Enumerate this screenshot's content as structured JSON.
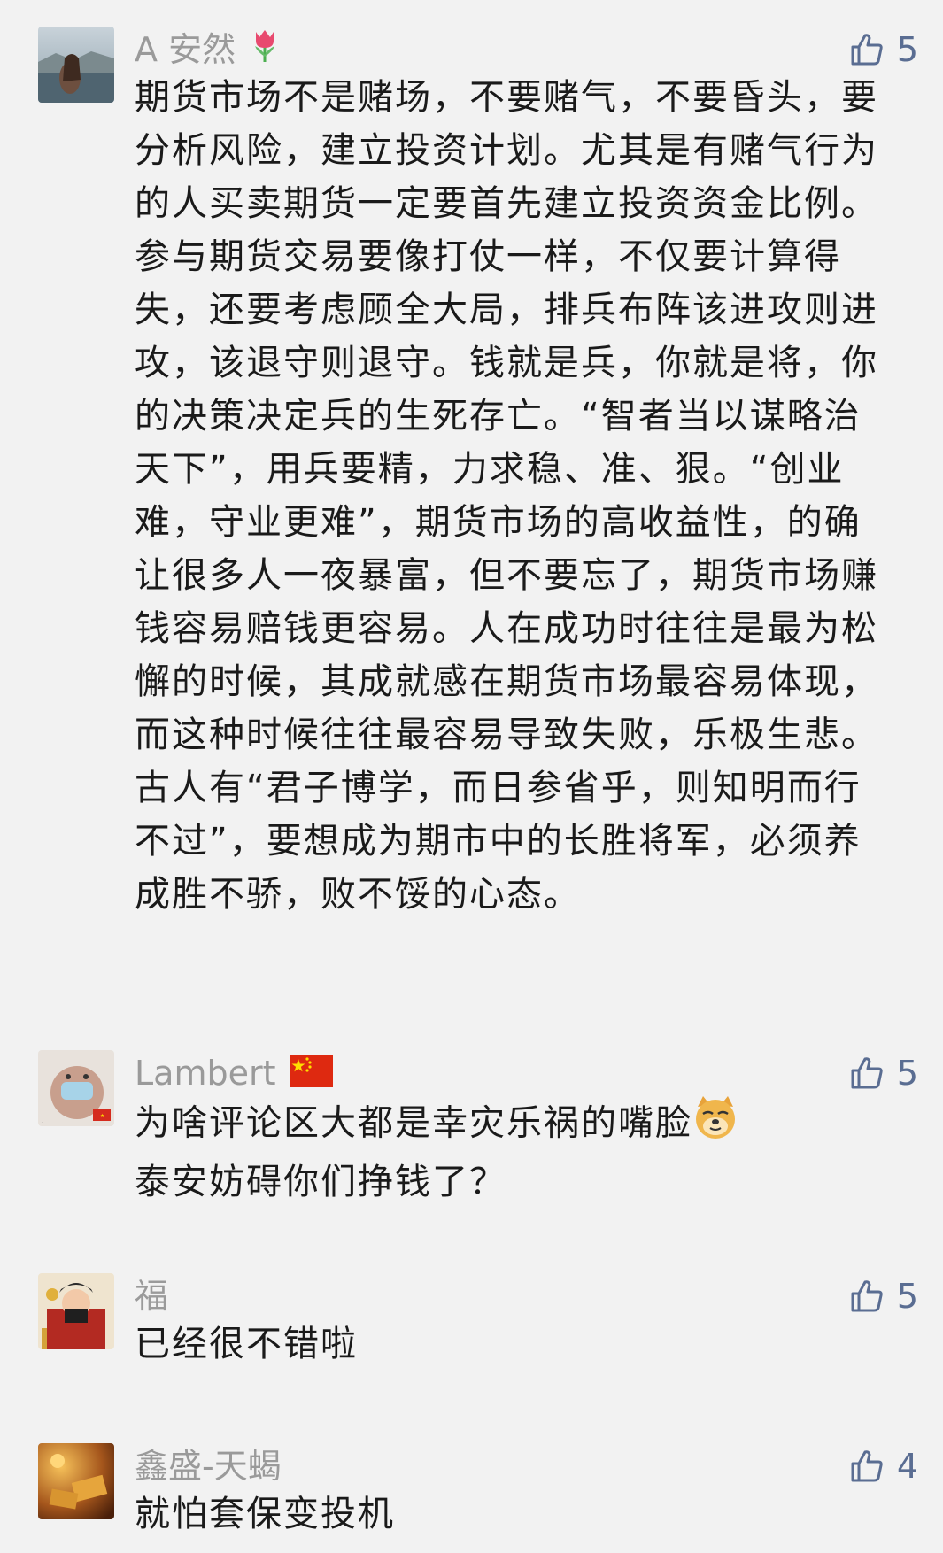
{
  "comments": [
    {
      "username": "A 安然",
      "username_emoji": "tulip",
      "likes": "5",
      "text": "期货市场不是赌场，不要赌气，不要昏头，要分析风险，建立投资计划。尤其是有赌气行为的人买卖期货一定要首先建立投资资金比例。参与期货交易要像打仗一样，不仅要计算得失，还要考虑顾全大局，排兵布阵该进攻则进攻，该退守则退守。钱就是兵，你就是将，你的决策决定兵的生死存亡。“智者当以谋略治天下”，用兵要精，力求稳、准、狠。“创业难，守业更难”，期货市场的高收益性，的确让很多人一夜暴富，但不要忘了，期货市场赚钱容易赔钱更容易。人在成功时往往是最为松懈的时候，其成就感在期货市场最容易体现，而这种时候往往最容易导致失败，乐极生悲。古人有“君子博学，而日参省乎，则知明而行不过”，要想成为期市中的长胜将军，必须养成胜不骄，败不馁的心态。"
    },
    {
      "username": "Lambert",
      "username_emoji": "china-flag",
      "likes": "5",
      "text_line1": "为啥评论区大都是幸灾乐祸的嘴脸",
      "text_line1_emoji": "doge",
      "text_line2": "泰安妨碍你们挣钱了？"
    },
    {
      "username": "福",
      "likes": "5",
      "text": "已经很不错啦"
    },
    {
      "username": "鑫盛-天蝎",
      "likes": "4",
      "text": "就怕套保变投机"
    }
  ],
  "colors": {
    "background": "#f2f2f2",
    "username": "#9a9a9a",
    "body_text": "#1a1a1a",
    "like_accent": "#5a6d92"
  },
  "icons": {
    "like": "thumbs-up-icon"
  }
}
